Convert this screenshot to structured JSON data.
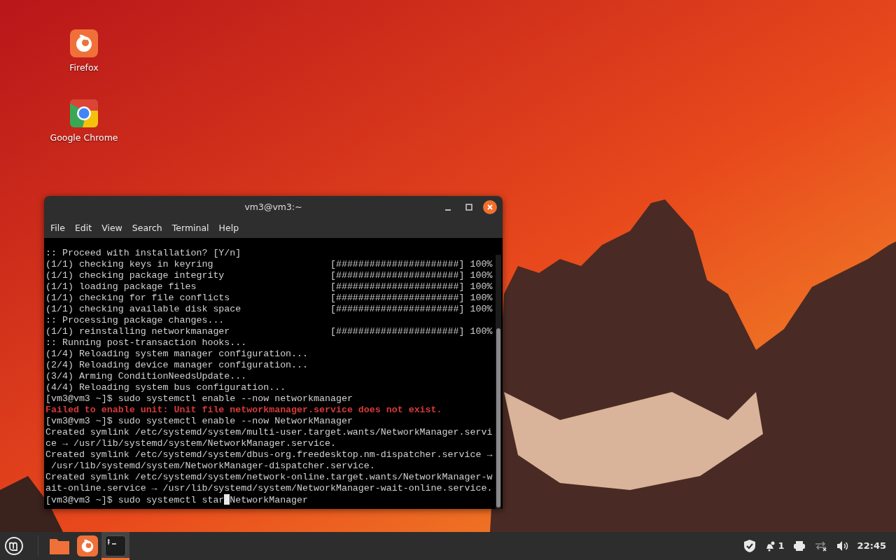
{
  "desktop_icons": [
    {
      "kind": "firefox",
      "label": "Firefox"
    },
    {
      "kind": "chrome",
      "label": "Google Chrome"
    }
  ],
  "window": {
    "title": "vm3@vm3:~",
    "menu": [
      "File",
      "Edit",
      "View",
      "Search",
      "Terminal",
      "Help"
    ]
  },
  "terminal": {
    "lines": [
      {
        "kind": "normal",
        "text": ":: Proceed with installation? [Y/n]"
      },
      {
        "kind": "normal",
        "text": "(1/1) checking keys in keyring                     [######################] 100%"
      },
      {
        "kind": "normal",
        "text": "(1/1) checking package integrity                   [######################] 100%"
      },
      {
        "kind": "normal",
        "text": "(1/1) loading package files                        [######################] 100%"
      },
      {
        "kind": "normal",
        "text": "(1/1) checking for file conflicts                  [######################] 100%"
      },
      {
        "kind": "normal",
        "text": "(1/1) checking available disk space                [######################] 100%"
      },
      {
        "kind": "normal",
        "text": ":: Processing package changes..."
      },
      {
        "kind": "normal",
        "text": "(1/1) reinstalling networkmanager                  [######################] 100%"
      },
      {
        "kind": "normal",
        "text": ":: Running post-transaction hooks..."
      },
      {
        "kind": "normal",
        "text": "(1/4) Reloading system manager configuration..."
      },
      {
        "kind": "normal",
        "text": "(2/4) Reloading device manager configuration..."
      },
      {
        "kind": "normal",
        "text": "(3/4) Arming ConditionNeedsUpdate..."
      },
      {
        "kind": "normal",
        "text": "(4/4) Reloading system bus configuration..."
      },
      {
        "kind": "normal",
        "text": "[vm3@vm3 ~]$ sudo systemctl enable --now networkmanager"
      },
      {
        "kind": "error",
        "text": "Failed to enable unit: Unit file networkmanager.service does not exist."
      },
      {
        "kind": "normal",
        "text": "[vm3@vm3 ~]$ sudo systemctl enable --now NetworkManager"
      },
      {
        "kind": "normal",
        "text": "Created symlink /etc/systemd/system/multi-user.target.wants/NetworkManager.servi"
      },
      {
        "kind": "normal",
        "text": "ce → /usr/lib/systemd/system/NetworkManager.service."
      },
      {
        "kind": "normal",
        "text": "Created symlink /etc/systemd/system/dbus-org.freedesktop.nm-dispatcher.service →"
      },
      {
        "kind": "normal",
        "text": " /usr/lib/systemd/system/NetworkManager-dispatcher.service."
      },
      {
        "kind": "normal",
        "text": "Created symlink /etc/systemd/system/network-online.target.wants/NetworkManager-w"
      },
      {
        "kind": "normal",
        "text": "ait-online.service → /usr/lib/systemd/system/NetworkManager-wait-online.service."
      },
      {
        "kind": "input",
        "text": "[vm3@vm3 ~]$ sudo systemctl star",
        "after_cursor": "NetworkManager"
      }
    ]
  },
  "taskbar": {
    "apps": [
      {
        "kind": "folder",
        "selected": false
      },
      {
        "kind": "firefox",
        "selected": false
      },
      {
        "kind": "terminal",
        "selected": true
      }
    ],
    "notification_count": "1",
    "clock": "22:45"
  }
}
